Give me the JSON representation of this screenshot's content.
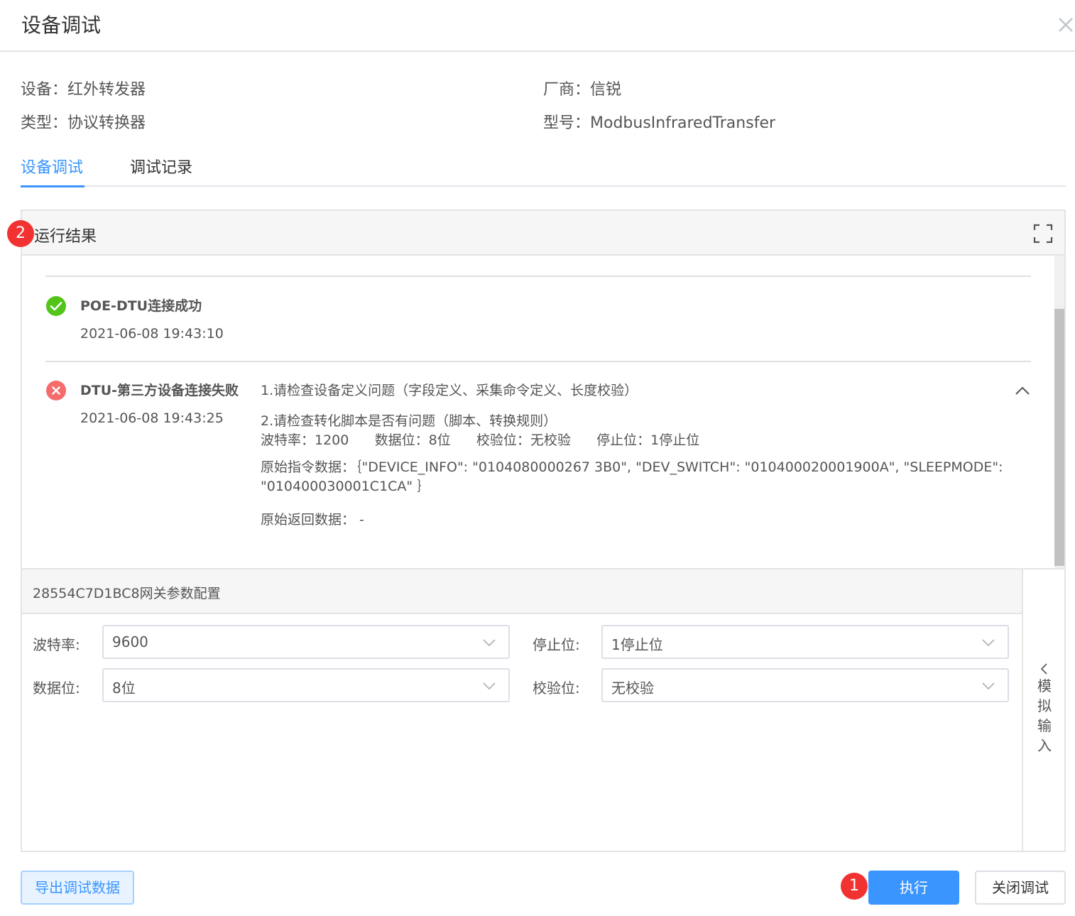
{
  "dialog": {
    "title": "设备调试"
  },
  "device_info": {
    "device_label": "设备：",
    "device_value": "红外转发器",
    "vendor_label": "厂商：",
    "vendor_value": "信锐",
    "type_label": "类型：",
    "type_value": "协议转换器",
    "model_label": "型号：",
    "model_value": "ModbusInfraredTransfer"
  },
  "tabs": [
    {
      "label": "设备调试",
      "active": true
    },
    {
      "label": "调试记录",
      "active": false
    }
  ],
  "results_panel": {
    "title": "运行结果",
    "badge": "2",
    "items": [
      {
        "status": "success",
        "title": "POE-DTU连接成功",
        "time": "2021-06-08 19:43:10"
      },
      {
        "status": "error",
        "title": "DTU-第三方设备连接失败",
        "time": "2021-06-08 19:43:25",
        "hint1": "1.请检查设备定义问题（字段定义、采集命令定义、长度校验）",
        "hint2": "2.请检查转化脚本是否有问题（脚本、转换规则）",
        "params": "波特率：1200      数据位：8位      校验位：无校验      停止位：1停止位",
        "raw_command": "原始指令数据：｛\"DEVICE_INFO\": \"0104080000267 3B0\", \"DEV_SWITCH\": \"010400020001900A\", \"SLEEPMODE\": \"010400030001C1CA\" ｝",
        "raw_return": "原始返回数据： -"
      }
    ]
  },
  "gateway_config": {
    "title": "28554C7D1BC8网关参数配置",
    "baud_label": "波特率:",
    "baud_value": "9600",
    "stop_label": "停止位:",
    "stop_value": "1停止位",
    "data_label": "数据位:",
    "data_value": "8位",
    "parity_label": "校验位:",
    "parity_value": "无校验"
  },
  "simulate": {
    "label": "模拟输入"
  },
  "footer": {
    "export_label": "导出调试数据",
    "run_label": "执行",
    "close_label": "关闭调试",
    "run_badge": "1"
  },
  "colors": {
    "accent": "#3a95ff",
    "success": "#52c41a",
    "error": "#f56c6c",
    "badge": "#f23131"
  }
}
